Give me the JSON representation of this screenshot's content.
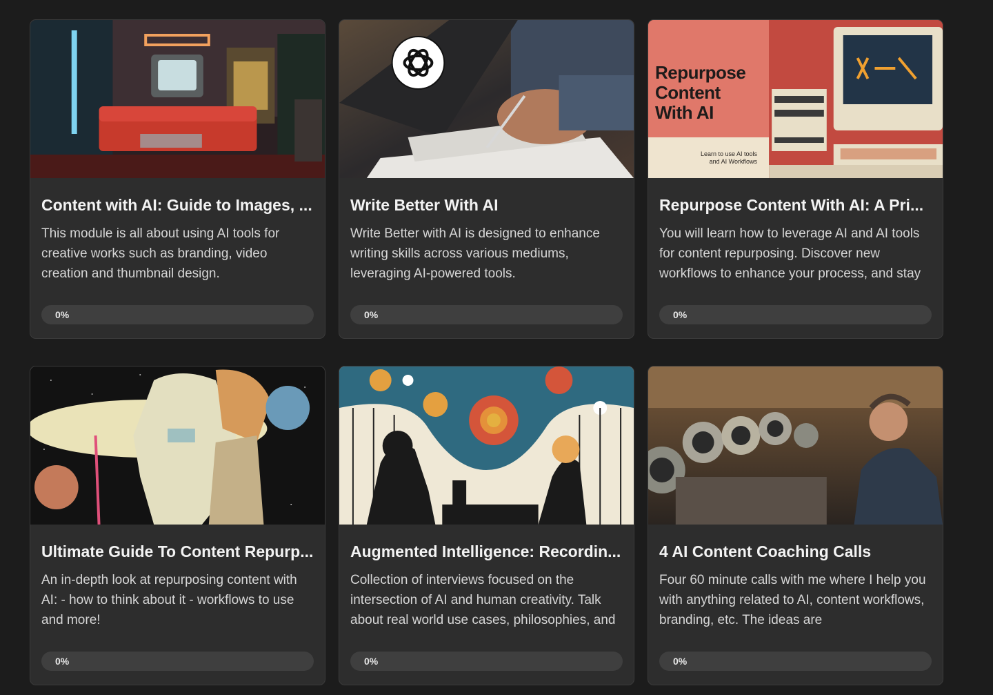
{
  "cards": [
    {
      "title": "Content with AI: Guide to Images, ...",
      "description": "This module is all about using AI tools for creative works such as branding, video creation and thumbnail design.",
      "progress": 0,
      "progress_label": "0%",
      "image_icon": "retro-living-room-image"
    },
    {
      "title": "Write Better With AI",
      "description": "Write Better with AI is designed to enhance writing skills across various mediums, leveraging AI-powered tools.",
      "progress": 0,
      "progress_label": "0%",
      "image_icon": "writing-hand-openai-logo-image"
    },
    {
      "title": "Repurpose Content With AI: A Pri...",
      "description": "You will learn how to leverage AI and AI tools for content repurposing. Discover new workflows to enhance your process, and stay",
      "progress": 0,
      "progress_label": "0%",
      "image_icon": "retro-computer-image",
      "image_title": "Repurpose Content With AI",
      "image_subtitle": "Learn to use AI tools and AI Workflows"
    },
    {
      "title": "Ultimate Guide To Content Repurp...",
      "description": "An in-depth look at repurposing content with AI: - how to think about it - workflows to use and more!",
      "progress": 0,
      "progress_label": "0%",
      "image_icon": "surreal-head-space-image"
    },
    {
      "title": "Augmented Intelligence: Recordin...",
      "description": "Collection of interviews focused on the intersection of AI and human creativity. Talk about real world use cases, philosophies, and",
      "progress": 0,
      "progress_label": "0%",
      "image_icon": "podcast-illustration-image"
    },
    {
      "title": "4 AI Content Coaching Calls",
      "description": "Four 60 minute calls with me where I help you with anything related to AI, content workflows, branding, etc. The ideas are",
      "progress": 0,
      "progress_label": "0%",
      "image_icon": "robots-workshop-image"
    }
  ],
  "colors": {
    "background": "#1c1c1c",
    "card": "#2d2d2d",
    "progress_track": "#3f3f3f",
    "title": "#f3f3f3",
    "body_text": "#d6d6d6"
  }
}
